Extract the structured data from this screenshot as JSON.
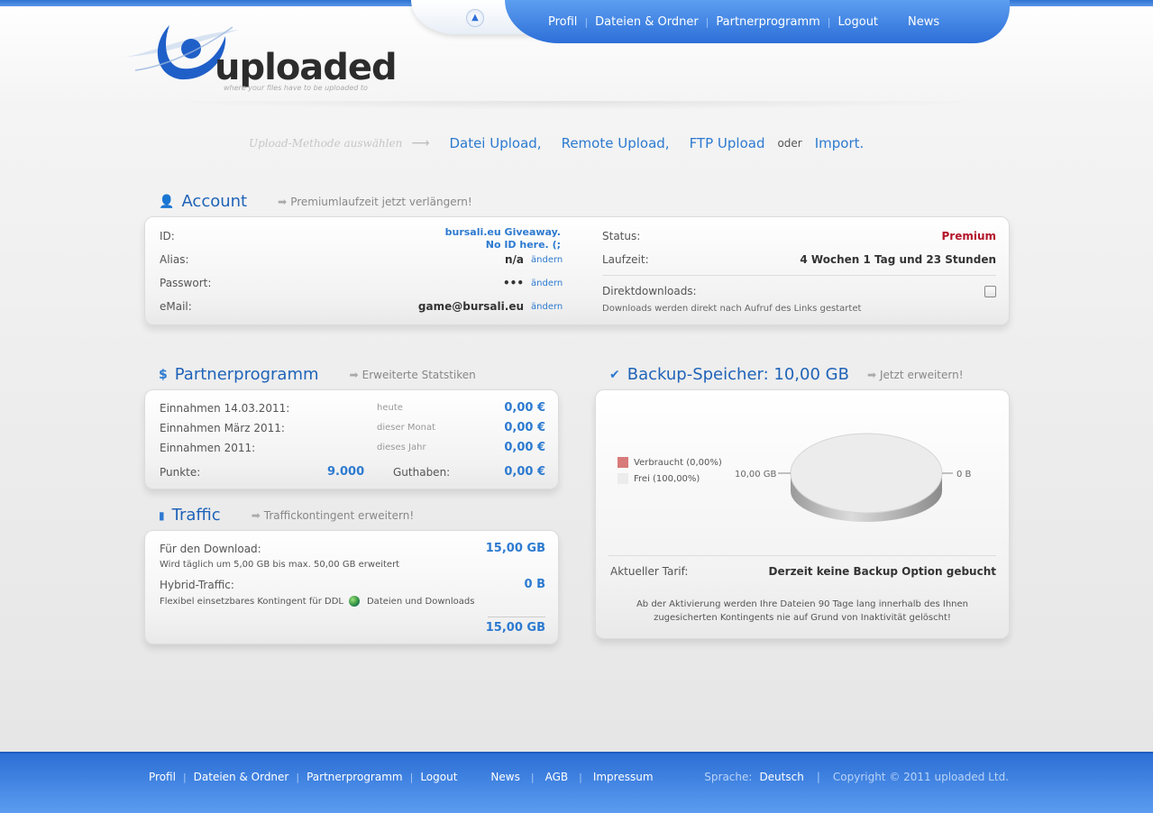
{
  "nav": {
    "items": [
      "Profil",
      "Dateien & Ordner",
      "Partnerprogramm",
      "Logout",
      "News"
    ]
  },
  "logo": {
    "text": "uploaded",
    "tagline": "where your files have to be uploaded to"
  },
  "upload": {
    "hint": "Upload-Methode auswählen",
    "datei": "Datei Upload,",
    "remote": "Remote Upload,",
    "ftp": "FTP Upload",
    "oder": "oder",
    "import": "Import."
  },
  "account": {
    "title": "Account",
    "extend": "Premiumlaufzeit jetzt verlängern!",
    "id_label": "ID:",
    "id_value_1": "bursali.eu Giveaway.",
    "id_value_2": "No ID here. (;",
    "alias_label": "Alias:",
    "alias_value": "n/a",
    "password_label": "Passwort:",
    "password_value": "•••",
    "email_label": "eMail:",
    "email_value": "game@bursali.eu",
    "change": "ändern",
    "status_label": "Status:",
    "status_value": "Premium",
    "runtime_label": "Laufzeit:",
    "runtime_value": "4 Wochen 1 Tag und 23 Stunden",
    "direct_label": "Direktdownloads:",
    "direct_desc": "Downloads werden direkt nach Aufruf des Links gestartet"
  },
  "partner": {
    "title": "Partnerprogramm",
    "stats": "Erweiterte Statstiken",
    "rows": [
      {
        "label": "Einnahmen 14.03.2011:",
        "period": "heute",
        "value": "0,00 €"
      },
      {
        "label": "Einnahmen März 2011:",
        "period": "dieser Monat",
        "value": "0,00 €"
      },
      {
        "label": "Einnahmen 2011:",
        "period": "dieses Jahr",
        "value": "0,00 €"
      }
    ],
    "points_label": "Punkte:",
    "points_value": "9.000",
    "credit_label": "Guthaben:",
    "credit_value": "0,00 €"
  },
  "traffic": {
    "title": "Traffic",
    "extend": "Traffickontingent erweitern!",
    "download_label": "Für den Download:",
    "download_value": "15,00 GB",
    "download_desc": "Wird täglich um 5,00 GB bis max. 50,00 GB erweitert",
    "hybrid_label": "Hybrid-Traffic:",
    "hybrid_value": "0 B",
    "hybrid_desc_1": "Flexibel einsetzbares Kontingent für DDL",
    "hybrid_desc_2": "Dateien und Downloads",
    "total": "15,00 GB"
  },
  "backup": {
    "title": "Backup-Speicher: 10,00 GB",
    "extend": "Jetzt erweitern!",
    "legend_used": "Verbraucht (0,00%)",
    "legend_free": "Frei (100,00%)",
    "label_left": "10,00 GB",
    "label_right": "0 B",
    "used_color": "#d87a7a",
    "free_color": "#ececec",
    "tarif_label": "Aktueller Tarif:",
    "tarif_value": "Derzeit keine Backup Option gebucht",
    "note_1": "Ab der Aktivierung werden Ihre Dateien 90 Tage lang innerhalb des Ihnen",
    "note_2": "zugesicherten Kontingents nie auf Grund von Inaktivität gelöscht!"
  },
  "footer": {
    "items": [
      "Profil",
      "Dateien & Ordner",
      "Partnerprogramm",
      "Logout",
      "News",
      "AGB",
      "Impressum"
    ],
    "lang_label": "Sprache:",
    "lang_value": "Deutsch",
    "copyright": "Copyright © 2011 uploaded Ltd."
  }
}
